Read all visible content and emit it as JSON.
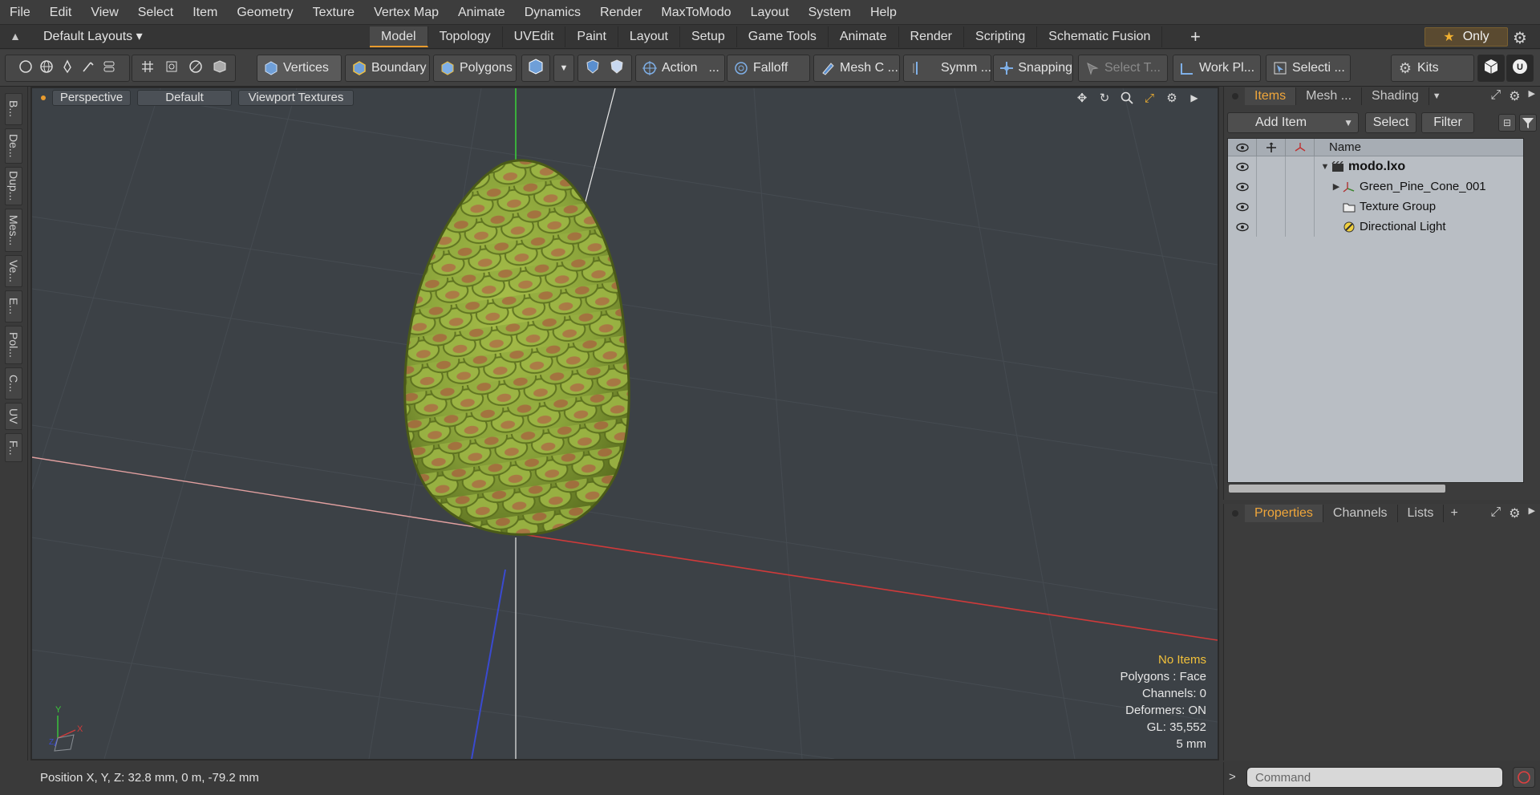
{
  "menu": [
    "File",
    "Edit",
    "View",
    "Select",
    "Item",
    "Geometry",
    "Texture",
    "Vertex Map",
    "Animate",
    "Dynamics",
    "Render",
    "MaxToModo",
    "Layout",
    "System",
    "Help"
  ],
  "layout": {
    "dropdown_label": "Default Layouts ▾",
    "tabs": [
      "Model",
      "Topology",
      "UVEdit",
      "Paint",
      "Layout",
      "Setup",
      "Game Tools",
      "Animate",
      "Render",
      "Scripting",
      "Schematic Fusion"
    ],
    "active_tab": "Model",
    "plus": "+",
    "only_label": "Only"
  },
  "toolbar": {
    "vertices": "Vertices",
    "boundary": "Boundary",
    "polygons": "Polygons",
    "action": "Action",
    "action_more": "...",
    "falloff": "Falloff",
    "mesh_c": "Mesh C ...",
    "symm": "Symm ...",
    "snapping": "Snapping",
    "select_t": "Select T...",
    "work_pl": "Work Pl...",
    "selecti": "Selecti ...",
    "kits": "Kits"
  },
  "left_tabs": [
    "B...",
    "De...",
    "Dup...",
    "Mes...",
    "Ve...",
    "E...",
    "Pol...",
    "C...",
    "UV",
    "F..."
  ],
  "viewport": {
    "perspective": "Perspective",
    "default": "Default",
    "textures": "Viewport Textures",
    "stats": {
      "no_items": "No Items",
      "polygons": "Polygons : Face",
      "channels": "Channels: 0",
      "deformers": "Deformers: ON",
      "gl": "GL: 35,552",
      "scale": "5 mm"
    }
  },
  "status": {
    "position": "Position X, Y, Z:   32.8 mm, 0 m, -79.2 mm"
  },
  "items_panel": {
    "tabs": [
      "Items",
      "Mesh ...",
      "Shading"
    ],
    "add_item": "Add Item",
    "select": "Select",
    "filter": "Filter",
    "name_header": "Name",
    "rows": [
      {
        "label": "modo.lxo",
        "icon": "scene-icon",
        "bold": true
      },
      {
        "label": "Green_Pine_Cone_001",
        "icon": "mesh-locator-icon",
        "bold": false
      },
      {
        "label": "Texture Group",
        "icon": "texture-group-icon",
        "bold": false
      },
      {
        "label": "Directional Light",
        "icon": "light-icon",
        "bold": false
      }
    ]
  },
  "props_panel": {
    "tabs": [
      "Properties",
      "Channels",
      "Lists"
    ],
    "plus": "+"
  },
  "command": {
    "placeholder": "Command"
  },
  "colors": {
    "accent": "#e89b2e",
    "stats_highlight": "#f2c13a",
    "axis_x": "#d03a3a",
    "axis_y": "#3acb3a",
    "axis_z": "#3a4ad0"
  }
}
